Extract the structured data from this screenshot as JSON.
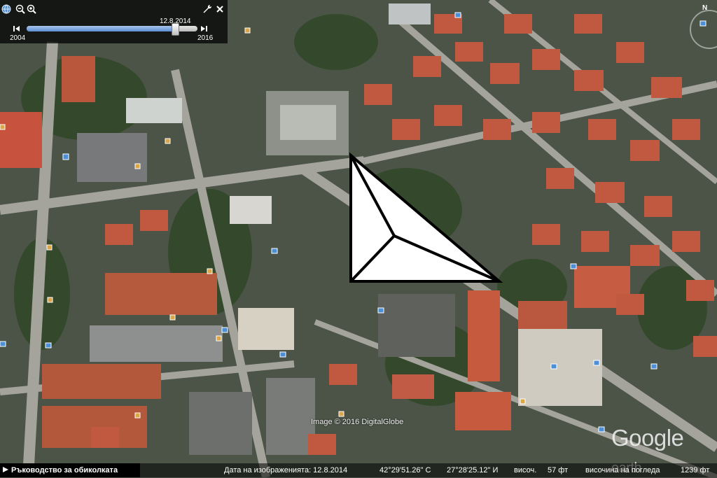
{
  "toolbar": {
    "icons": [
      "globe-icon",
      "zoom-out-icon",
      "zoom-in-icon",
      "wrench-icon",
      "close-icon"
    ],
    "historical_imagery": {
      "selected_date": "12.8.2014",
      "start_year": "2004",
      "end_year": "2016",
      "slider_position": 0.87
    }
  },
  "map": {
    "attribution": "Image © 2016 DigitalGlobe",
    "logo_text": "Google",
    "logo_tail": "earth",
    "compass_label": "N"
  },
  "status_bar": {
    "tour_guide": "Ръководство за обиколката",
    "image_date": "Дата на изображенията: 12.8.2014",
    "latitude": "42°29'51.26\" С",
    "longitude": "27°28'25.12\" И",
    "elevation_label": "височ.",
    "elevation_value": "57 фт",
    "eye_alt_label": "височина на погледа",
    "eye_alt_value": "1239 фт"
  },
  "colors": {
    "roof_red": "#b8573c",
    "vegetation": "#3c5a2e",
    "road": "#9c9c96",
    "accent_blue": "#5b8fd6"
  }
}
